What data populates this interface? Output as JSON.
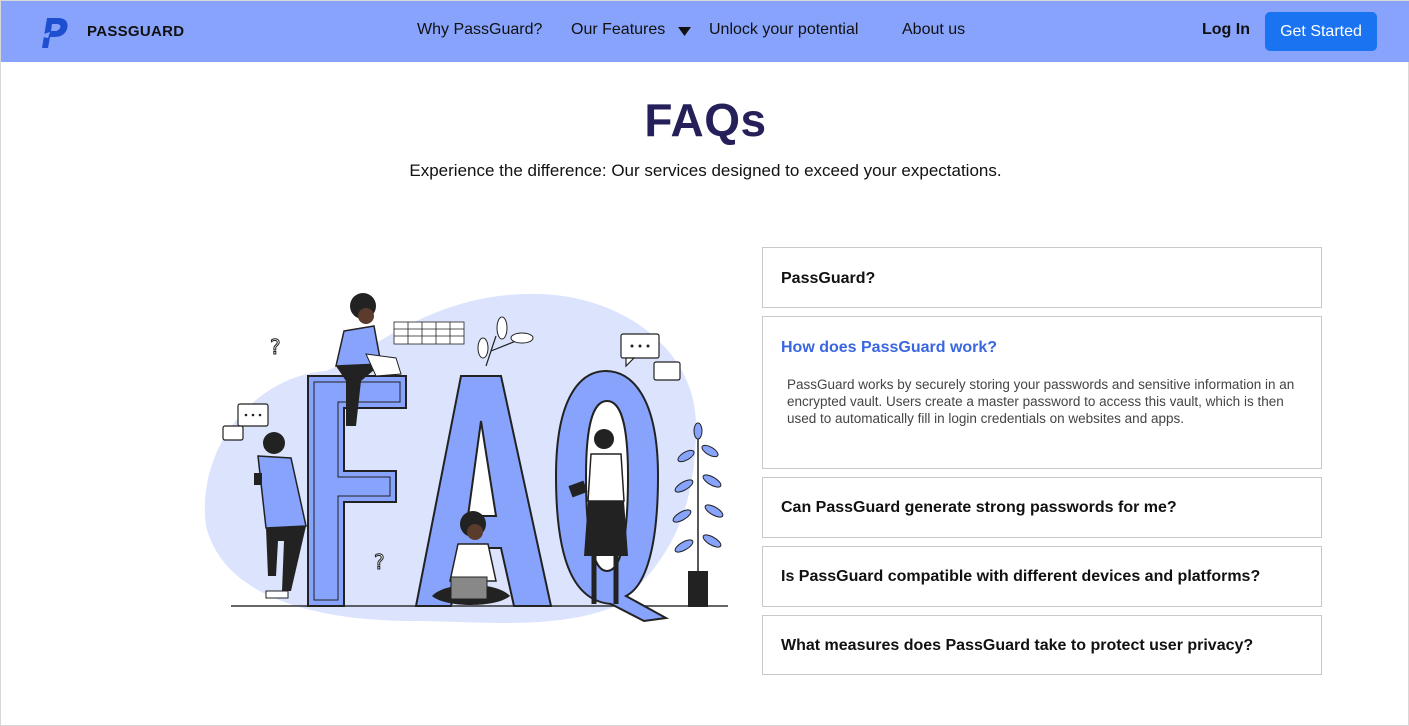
{
  "nav": {
    "brand": "PASSGUARD",
    "links": [
      {
        "label": "Why PassGuard?"
      },
      {
        "label": "Our Features"
      },
      {
        "label": "Unlock your potential"
      },
      {
        "label": "About us"
      }
    ],
    "login": "Log In",
    "cta": "Get Started",
    "icons": {
      "logo": "passguard-logo",
      "features_caret": "caret-down-icon"
    },
    "colors": {
      "navbar": "#87a3fb",
      "cta": "#1a73f0"
    }
  },
  "hero": {
    "title": "FAQs",
    "subtitle": "Experience the difference: Our services designed to exceed your expectations.",
    "title_color": "#25205a"
  },
  "faq": {
    "items": [
      {
        "question": "PassGuard?",
        "expanded": false
      },
      {
        "question": "How does PassGuard work?",
        "expanded": true,
        "answer": "PassGuard works by securely storing your passwords and sensitive information in an encrypted vault. Users create a master password to access this vault, which is then used to automatically fill in login credentials on websites and apps."
      },
      {
        "question": "Can PassGuard generate strong passwords for me?",
        "expanded": false
      },
      {
        "question": "Is PassGuard compatible with different devices and platforms?",
        "expanded": false
      },
      {
        "question": "What measures does PassGuard take to protect user privacy?",
        "expanded": false
      }
    ],
    "active_color": "#3a66e0"
  },
  "illustration": {
    "subject": "faq-illustration",
    "accent": "#87a3fb",
    "blob": "#dbe3fd"
  }
}
